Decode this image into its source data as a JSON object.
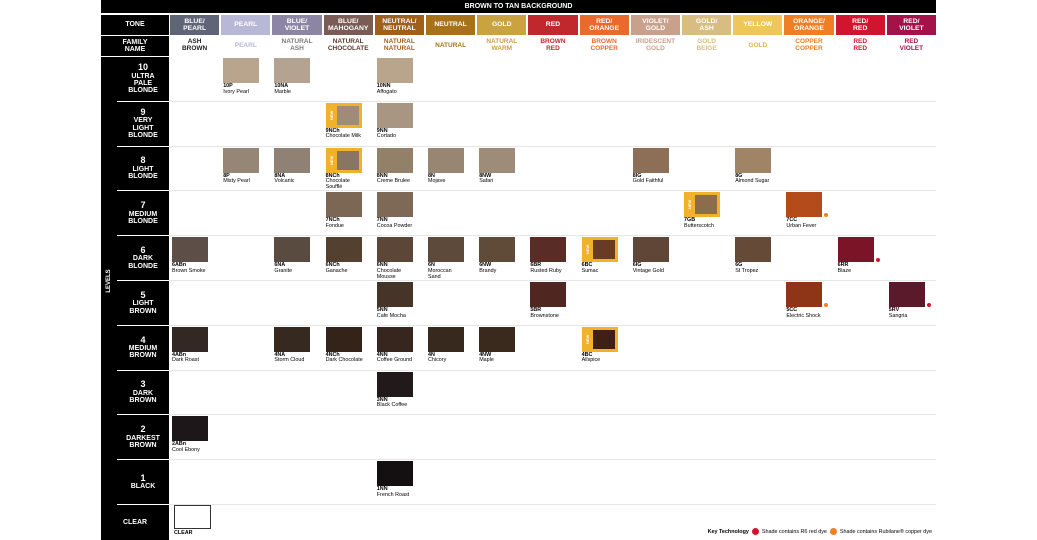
{
  "header": {
    "title": "BROWN TO TAN BACKGROUND",
    "tone_label": "TONE",
    "family_label": "FAMILY\nNAME",
    "levels_label": "LEVELS",
    "clear_label": "CLEAR"
  },
  "tones": [
    {
      "label": "BLUE/\nPEARL",
      "bg": "#5f6477",
      "fam": "ASH\nBROWN",
      "famcolor": "#222222"
    },
    {
      "label": "PEARL",
      "bg": "#b7b7d6",
      "fam": "PEARL",
      "famcolor": "#b7b7d6"
    },
    {
      "label": "BLUE/\nVIOLET",
      "bg": "#8c86a4",
      "fam": "NATURAL\nASH",
      "famcolor": "#7a7a7a"
    },
    {
      "label": "BLUE/\nMAHOGANY",
      "bg": "#7b5b55",
      "fam": "NATURAL\nCHOCOLATE",
      "famcolor": "#5b3b2b"
    },
    {
      "label": "NEUTRAL/\nNEUTRAL",
      "bg": "#a15f1c",
      "fam": "NATURAL\nNATURAL",
      "famcolor": "#a15f1c"
    },
    {
      "label": "NEUTRAL",
      "bg": "#a8721a",
      "fam": "NATURAL",
      "famcolor": "#a8721a"
    },
    {
      "label": "GOLD",
      "bg": "#c9a33f",
      "fam": "NATURAL\nWARM",
      "famcolor": "#c9a33f"
    },
    {
      "label": "RED",
      "bg": "#c0282e",
      "fam": "BROWN\nRED",
      "famcolor": "#c0282e"
    },
    {
      "label": "RED/\nORANGE",
      "bg": "#ea6a2d",
      "fam": "BROWN\nCOPPER",
      "famcolor": "#ea6a2d"
    },
    {
      "label": "VIOLET/\nGOLD",
      "bg": "#c9a08b",
      "fam": "IRIDESCENT\nGOLD",
      "famcolor": "#c9a08b"
    },
    {
      "label": "GOLD/\nASH",
      "bg": "#d8bd83",
      "fam": "GOLD\nBEIGE",
      "famcolor": "#d8bd83"
    },
    {
      "label": "YELLOW",
      "bg": "#eec65a",
      "fam": "GOLD",
      "famcolor": "#e0b646"
    },
    {
      "label": "ORANGE/\nORANGE",
      "bg": "#ef7f22",
      "fam": "COPPER\nCOPPER",
      "famcolor": "#ef7f22"
    },
    {
      "label": "RED/\nRED",
      "bg": "#d2152e",
      "fam": "RED\nRED",
      "famcolor": "#d2152e"
    },
    {
      "label": "RED/\nVIOLET",
      "bg": "#a3134a",
      "fam": "RED\nVIOLET",
      "famcolor": "#a3134a"
    }
  ],
  "levels": [
    {
      "num": "10",
      "name": "ULTRA\nPALE\nBLONDE"
    },
    {
      "num": "9",
      "name": "VERY\nLIGHT\nBLONDE"
    },
    {
      "num": "8",
      "name": "LIGHT\nBLONDE"
    },
    {
      "num": "7",
      "name": "MEDIUM\nBLONDE"
    },
    {
      "num": "6",
      "name": "DARK\nBLONDE"
    },
    {
      "num": "5",
      "name": "LIGHT\nBROWN"
    },
    {
      "num": "4",
      "name": "MEDIUM\nBROWN"
    },
    {
      "num": "3",
      "name": "DARK\nBROWN"
    },
    {
      "num": "2",
      "name": "DARKEST\nBROWN"
    },
    {
      "num": "1",
      "name": "BLACK"
    }
  ],
  "shades": [
    {
      "col": 1,
      "lvl": 0,
      "code": "10P",
      "name": "Ivory Pearl",
      "color": "#b9a48e"
    },
    {
      "col": 2,
      "lvl": 0,
      "code": "10NA",
      "name": "Marble",
      "color": "#b4a390"
    },
    {
      "col": 4,
      "lvl": 0,
      "code": "10NN",
      "name": "Affogato",
      "color": "#b8a58c"
    },
    {
      "col": 3,
      "lvl": 1,
      "code": "9NCh",
      "name": "Chocolate Milk",
      "color": "#a08b78",
      "new": true
    },
    {
      "col": 4,
      "lvl": 1,
      "code": "9NN",
      "name": "Cortado",
      "color": "#a89582"
    },
    {
      "col": 1,
      "lvl": 2,
      "code": "8P",
      "name": "Misty Pearl",
      "color": "#968676"
    },
    {
      "col": 2,
      "lvl": 2,
      "code": "8NA",
      "name": "Volcanic",
      "color": "#8f8275"
    },
    {
      "col": 3,
      "lvl": 2,
      "code": "8NCh",
      "name": "Chocolate\nSoufflé",
      "color": "#8a7563",
      "new": true
    },
    {
      "col": 4,
      "lvl": 2,
      "code": "8NN",
      "name": "Creme Brulee",
      "color": "#938069"
    },
    {
      "col": 5,
      "lvl": 2,
      "code": "8N",
      "name": "Mojave",
      "color": "#978672"
    },
    {
      "col": 6,
      "lvl": 2,
      "code": "8NW",
      "name": "Safari",
      "color": "#9d8c77"
    },
    {
      "col": 9,
      "lvl": 2,
      "code": "8IG",
      "name": "Gold Faithful",
      "color": "#8d6e56"
    },
    {
      "col": 11,
      "lvl": 2,
      "code": "8G",
      "name": "Almond Sugar",
      "color": "#a08466"
    },
    {
      "col": 3,
      "lvl": 3,
      "code": "7NCh",
      "name": "Fondue",
      "color": "#7c6654"
    },
    {
      "col": 4,
      "lvl": 3,
      "code": "7NN",
      "name": "Cocoa Powder",
      "color": "#7e6957"
    },
    {
      "col": 10,
      "lvl": 3,
      "code": "7GB",
      "name": "Butterscotch",
      "color": "#8b6d4e",
      "new": true
    },
    {
      "col": 12,
      "lvl": 3,
      "code": "7CC",
      "name": "Urban Fever",
      "color": "#b34b1b",
      "dot": "#ef7f22"
    },
    {
      "col": 0,
      "lvl": 4,
      "code": "6ABn",
      "name": "Brown Smoke",
      "color": "#5d4e47"
    },
    {
      "col": 2,
      "lvl": 4,
      "code": "6NA",
      "name": "Granite",
      "color": "#5a4b40"
    },
    {
      "col": 3,
      "lvl": 4,
      "code": "6NCh",
      "name": "Ganache",
      "color": "#54402f"
    },
    {
      "col": 4,
      "lvl": 4,
      "code": "6NN",
      "name": "Chocolate\nMousse",
      "color": "#5b4638"
    },
    {
      "col": 5,
      "lvl": 4,
      "code": "6N",
      "name": "Moroccan\nSand",
      "color": "#5d4a3b"
    },
    {
      "col": 6,
      "lvl": 4,
      "code": "6NW",
      "name": "Brandy",
      "color": "#604a38"
    },
    {
      "col": 7,
      "lvl": 4,
      "code": "6BR",
      "name": "Rusted Ruby",
      "color": "#5a2c26"
    },
    {
      "col": 8,
      "lvl": 4,
      "code": "6BC",
      "name": "Sumac",
      "color": "#6a3b24",
      "new": true
    },
    {
      "col": 9,
      "lvl": 4,
      "code": "6IG",
      "name": "Vintage Gold",
      "color": "#604636"
    },
    {
      "col": 11,
      "lvl": 4,
      "code": "6G",
      "name": "St Tropez",
      "color": "#654a37"
    },
    {
      "col": 13,
      "lvl": 4,
      "code": "6RR",
      "name": "Blaze",
      "color": "#7a1426",
      "dot": "#d2152e"
    },
    {
      "col": 4,
      "lvl": 5,
      "code": "5NN",
      "name": "Cafe Mocha",
      "color": "#463429"
    },
    {
      "col": 7,
      "lvl": 5,
      "code": "5BR",
      "name": "Brownstone",
      "color": "#4f2620"
    },
    {
      "col": 12,
      "lvl": 5,
      "code": "5CC",
      "name": "Electric Shock",
      "color": "#8e3417",
      "dot": "#ef7f22"
    },
    {
      "col": 14,
      "lvl": 5,
      "code": "5RV",
      "name": "Sangria",
      "color": "#5a1a2c",
      "dot": "#d2152e"
    },
    {
      "col": 0,
      "lvl": 6,
      "code": "4ABn",
      "name": "Dark Roast",
      "color": "#332823"
    },
    {
      "col": 2,
      "lvl": 6,
      "code": "4NA",
      "name": "Storm Cloud",
      "color": "#36291f"
    },
    {
      "col": 3,
      "lvl": 6,
      "code": "4NCh",
      "name": "Dark Chocolate",
      "color": "#342319"
    },
    {
      "col": 4,
      "lvl": 6,
      "code": "4NN",
      "name": "Coffee Ground",
      "color": "#36261d"
    },
    {
      "col": 5,
      "lvl": 6,
      "code": "4N",
      "name": "Chicory",
      "color": "#38291f"
    },
    {
      "col": 6,
      "lvl": 6,
      "code": "4NW",
      "name": "Maple",
      "color": "#3a2a1e"
    },
    {
      "col": 8,
      "lvl": 6,
      "code": "4BC",
      "name": "Allspice",
      "color": "#3e2016",
      "new": true
    },
    {
      "col": 4,
      "lvl": 7,
      "code": "3NN",
      "name": "Black Coffee",
      "color": "#22191a"
    },
    {
      "col": 0,
      "lvl": 8,
      "code": "2ABn",
      "name": "Cool Ebony",
      "color": "#1d1719"
    },
    {
      "col": 4,
      "lvl": 9,
      "code": "1NN",
      "name": "French Roast",
      "color": "#141012"
    }
  ],
  "clear": {
    "code": "CLEAR"
  },
  "key": {
    "title": "Key Technology",
    "red": "Shade contains R6 red dye",
    "copper": "Shade contains Rubilane® copper dye",
    "red_color": "#d2152e",
    "copper_color": "#ef7f22"
  },
  "new_tag": "NEW"
}
